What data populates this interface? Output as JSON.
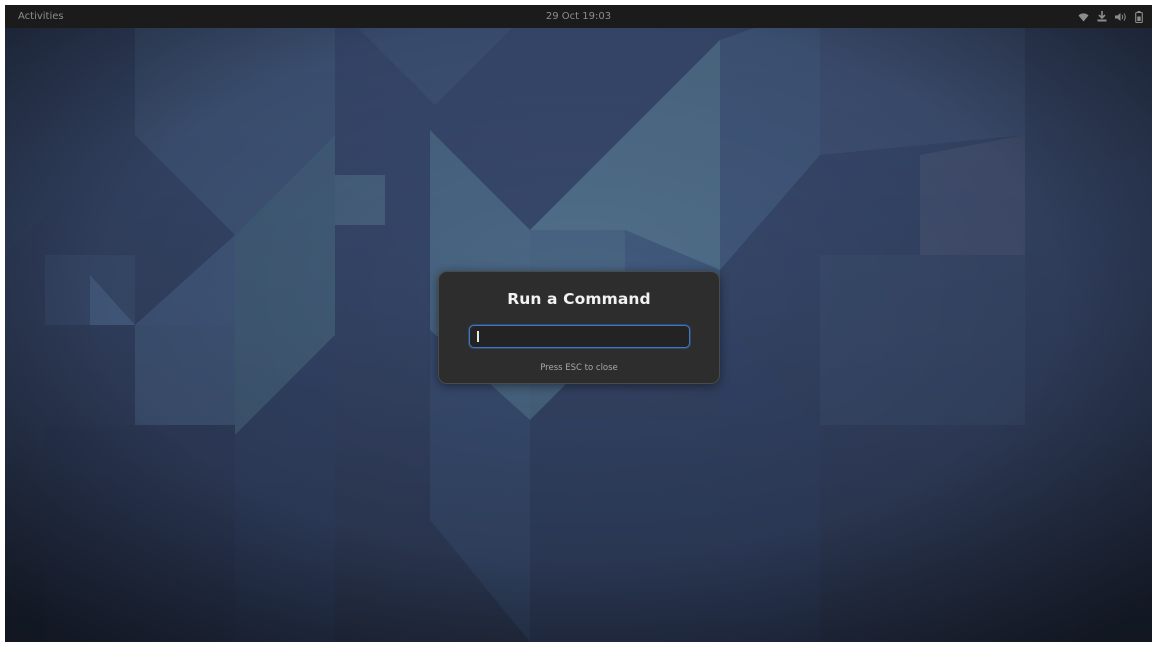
{
  "topbar": {
    "activities_label": "Activities",
    "clock_text": "29 Oct  19:03",
    "tray_icons": [
      "wifi-icon",
      "network-icon",
      "volume-icon",
      "battery-icon"
    ]
  },
  "run_dialog": {
    "title": "Run a Command",
    "input_value": "",
    "hint": "Press ESC to close",
    "accent_color": "#3f77c7"
  },
  "colors": {
    "topbar": "#1b1b1b",
    "dialog": "#2d2d2d",
    "wallpaper": "#3b4a6b"
  }
}
